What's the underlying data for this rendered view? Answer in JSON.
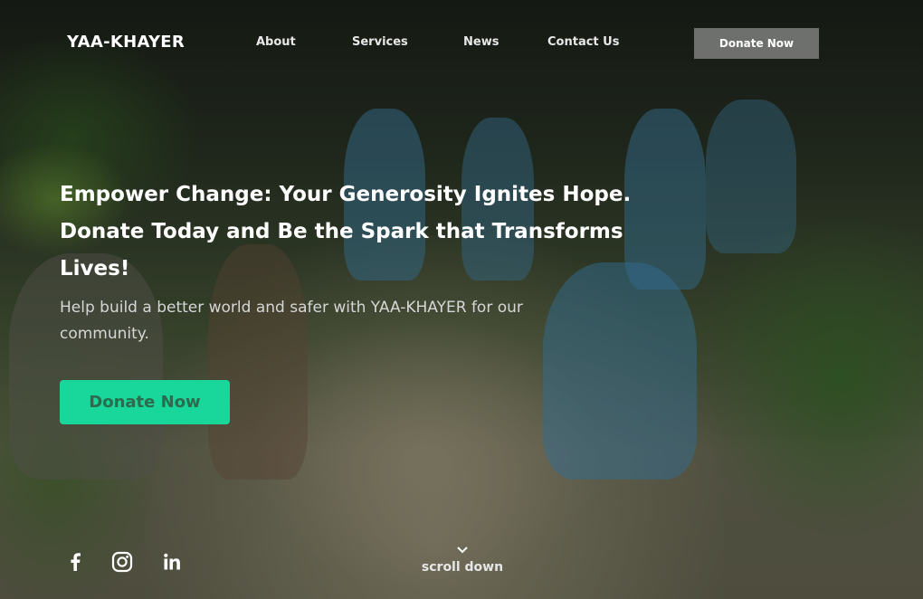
{
  "brand": {
    "name": "YAA-KHAYER"
  },
  "nav": {
    "links": [
      {
        "label": "About"
      },
      {
        "label": "Services"
      },
      {
        "label": "News"
      },
      {
        "label": "Contact Us"
      }
    ],
    "donate_label": "Donate Now"
  },
  "hero": {
    "headline": "Empower Change: Your Generosity Ignites Hope. Donate Today and Be the Spark that Transforms Lives!",
    "subtext": "Help build a better world and safer with YAA-KHAYER for our community.",
    "cta_label": "Donate Now",
    "background": "children with backpacks walking down a dirt path"
  },
  "social": [
    {
      "icon": "facebook-icon"
    },
    {
      "icon": "instagram-icon"
    },
    {
      "icon": "linkedin-icon"
    }
  ],
  "scroll": {
    "label": "scroll down",
    "icon": "chevron-down-icon"
  },
  "colors": {
    "accent": "#19d69b",
    "accent_text": "#2b6b4e",
    "nav_button": "#8c8c8c"
  }
}
